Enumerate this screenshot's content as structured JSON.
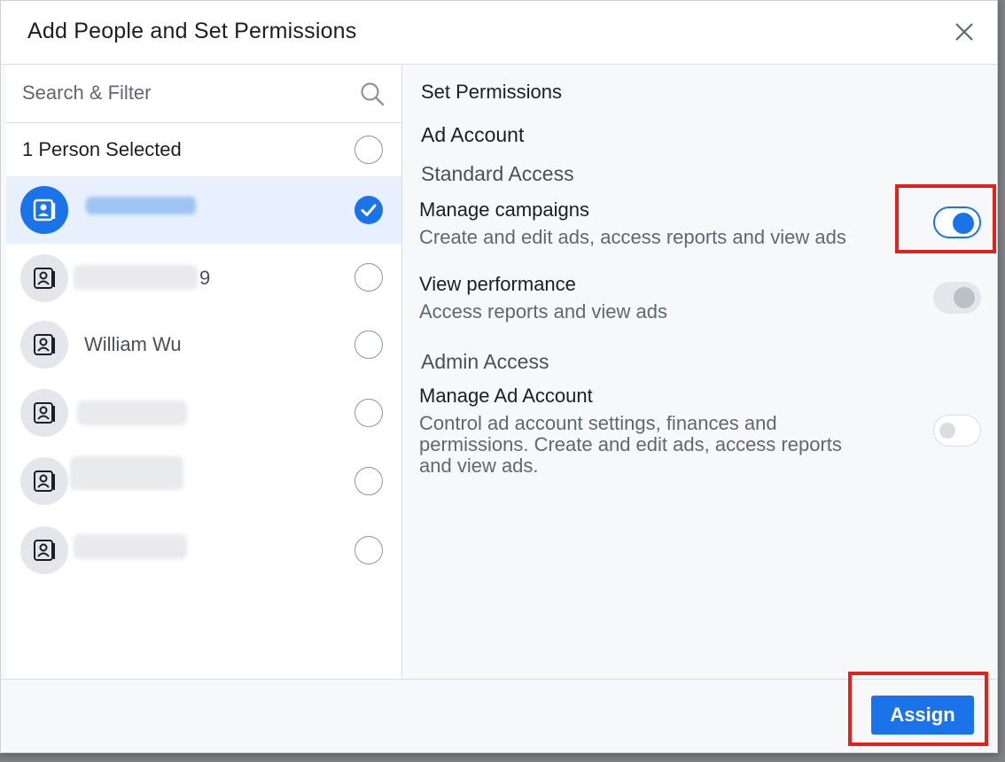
{
  "dialog": {
    "title": "Add People and Set Permissions",
    "close_icon": "close-icon"
  },
  "left": {
    "search": {
      "placeholder": "Search & Filter",
      "value": ""
    },
    "selected_label": "1 Person Selected",
    "people": [
      {
        "name": "",
        "selected": true,
        "redacted": true
      },
      {
        "name": "9",
        "selected": false,
        "redacted": true
      },
      {
        "name": "William Wu",
        "selected": false,
        "redacted": false
      },
      {
        "name": "",
        "selected": false,
        "redacted": true
      },
      {
        "name": "",
        "selected": false,
        "redacted": true
      },
      {
        "name": "",
        "selected": false,
        "redacted": true
      }
    ]
  },
  "right": {
    "heading": "Set Permissions",
    "account_type": "Ad Account",
    "standard_access": "Standard Access",
    "admin_access": "Admin Access",
    "permissions": [
      {
        "title": "Manage campaigns",
        "description": "Create and edit ads, access reports and view ads",
        "state": "on"
      },
      {
        "title": "View performance",
        "description": "Access reports and view ads",
        "state": "on-disabled"
      },
      {
        "title": "Manage Ad Account",
        "description_lines": [
          "Control ad account settings, finances and",
          "permissions. Create and edit ads, access reports",
          "and view ads."
        ],
        "state": "off"
      }
    ]
  },
  "footer": {
    "assign_label": "Assign"
  },
  "colors": {
    "accent": "#1a73e8",
    "highlight": "#e0221d"
  }
}
